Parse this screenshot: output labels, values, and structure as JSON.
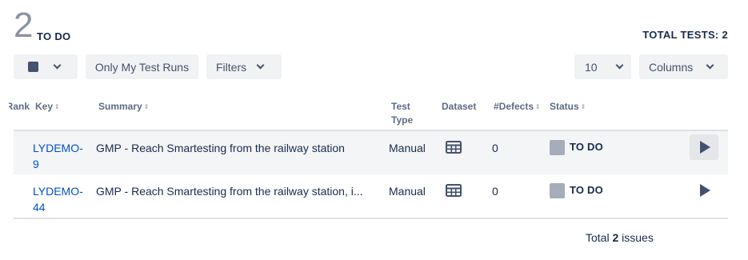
{
  "header": {
    "count": "2",
    "status_label": "TO DO",
    "total_tests": "TOTAL TESTS: 2"
  },
  "toolbar": {
    "only_my_runs": "Only My Test Runs",
    "filters": "Filters",
    "page_size": "10",
    "columns": "Columns"
  },
  "table": {
    "columns": [
      "Rank",
      "Key",
      "Summary",
      "Test Type",
      "Dataset",
      "#Defects",
      "Status"
    ],
    "rows": [
      {
        "key": "LYDEMO-9",
        "summary": "GMP - Reach Smartesting from the railway station",
        "type": "Manual",
        "defects": "0",
        "status": "TO DO"
      },
      {
        "key": "LYDEMO-44",
        "summary": "GMP - Reach Smartesting from the railway station, i...",
        "type": "Manual",
        "defects": "0",
        "status": "TO DO"
      }
    ]
  },
  "footer": {
    "prefix": "Total",
    "count": "2",
    "suffix": "issues"
  },
  "colors": {
    "status_todo": "#a5adba",
    "link": "#0052cc",
    "count_gray": "#8993a4"
  },
  "icons": [
    "stop-square-icon",
    "chevron-down-icon",
    "sort-icon",
    "dataset-grid-icon",
    "play-icon"
  ]
}
